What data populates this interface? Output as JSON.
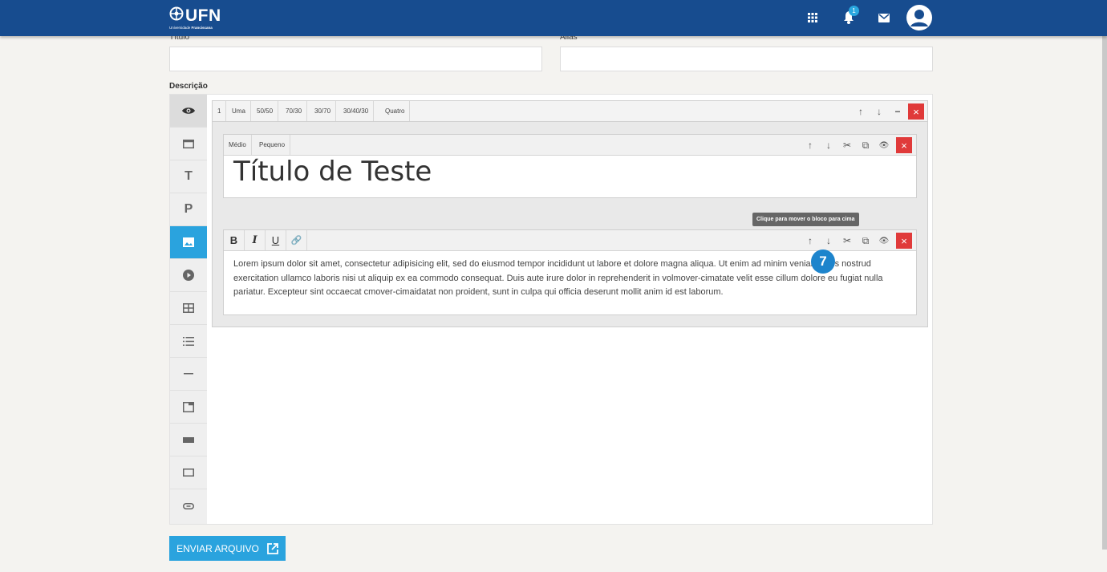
{
  "header": {
    "logo_text": "UFN",
    "logo_subtitle_a": "Universidade ",
    "logo_subtitle_b": "Franciscana",
    "notification_count": "1",
    "icons": [
      "apps-grid-icon",
      "bell-icon",
      "mail-icon",
      "user-avatar-icon"
    ]
  },
  "form": {
    "title_label": "Título",
    "title_value": "",
    "alias_label": "Alias",
    "alias_value": "",
    "description_label": "Descrição"
  },
  "sidebar_tools": [
    "eye-icon",
    "window-icon",
    "text-icon",
    "paragraph-icon",
    "image-icon",
    "video-icon",
    "table-icon",
    "list-icon",
    "divider-icon",
    "frame-icon",
    "bar-icon",
    "box-icon",
    "link-icon"
  ],
  "sidebar_letters": {
    "text": "T",
    "paragraph": "P"
  },
  "layout_bar": {
    "items": [
      "1",
      "Uma",
      "50/50",
      "70/30",
      "30/70",
      "30/40/30",
      "Quatro"
    ],
    "controls": [
      "↑",
      "↓",
      "−",
      "×"
    ]
  },
  "heading_block": {
    "sizes": [
      "Médio",
      "Pequeno"
    ],
    "text": "Título de Teste",
    "controls": [
      "↑",
      "↓",
      "✂",
      "⧉",
      "👁",
      "×"
    ]
  },
  "paragraph_block": {
    "format": [
      "B",
      "I",
      "U",
      "🔗"
    ],
    "text": "Lorem ipsum dolor sit amet, consectetur adipisicing elit, sed do eiusmod tempor incididunt ut labore et dolore magna aliqua. Ut enim ad minim veniam, quis nostrud exercitation ullamco laboris nisi ut aliquip ex ea commodo consequat. Duis aute irure dolor in reprehenderit in volmover-cimatate velit esse cillum dolore eu fugiat nulla pariatur. Excepteur sint occaecat cmover-cimaidatat non proident, sunt in culpa qui officia deserunt mollit anim id est laborum.",
    "controls": [
      "↑",
      "↓",
      "✂",
      "⧉",
      "👁",
      "×"
    ]
  },
  "tooltip": "Clique para mover o bloco para cima",
  "step_badge": "7",
  "upload_button": "ENVIAR ARQUIVO",
  "colors": {
    "topbar": "#174c8f",
    "accent": "#2aa3de",
    "danger": "#e03a3a",
    "badge": "#1d84cc"
  }
}
